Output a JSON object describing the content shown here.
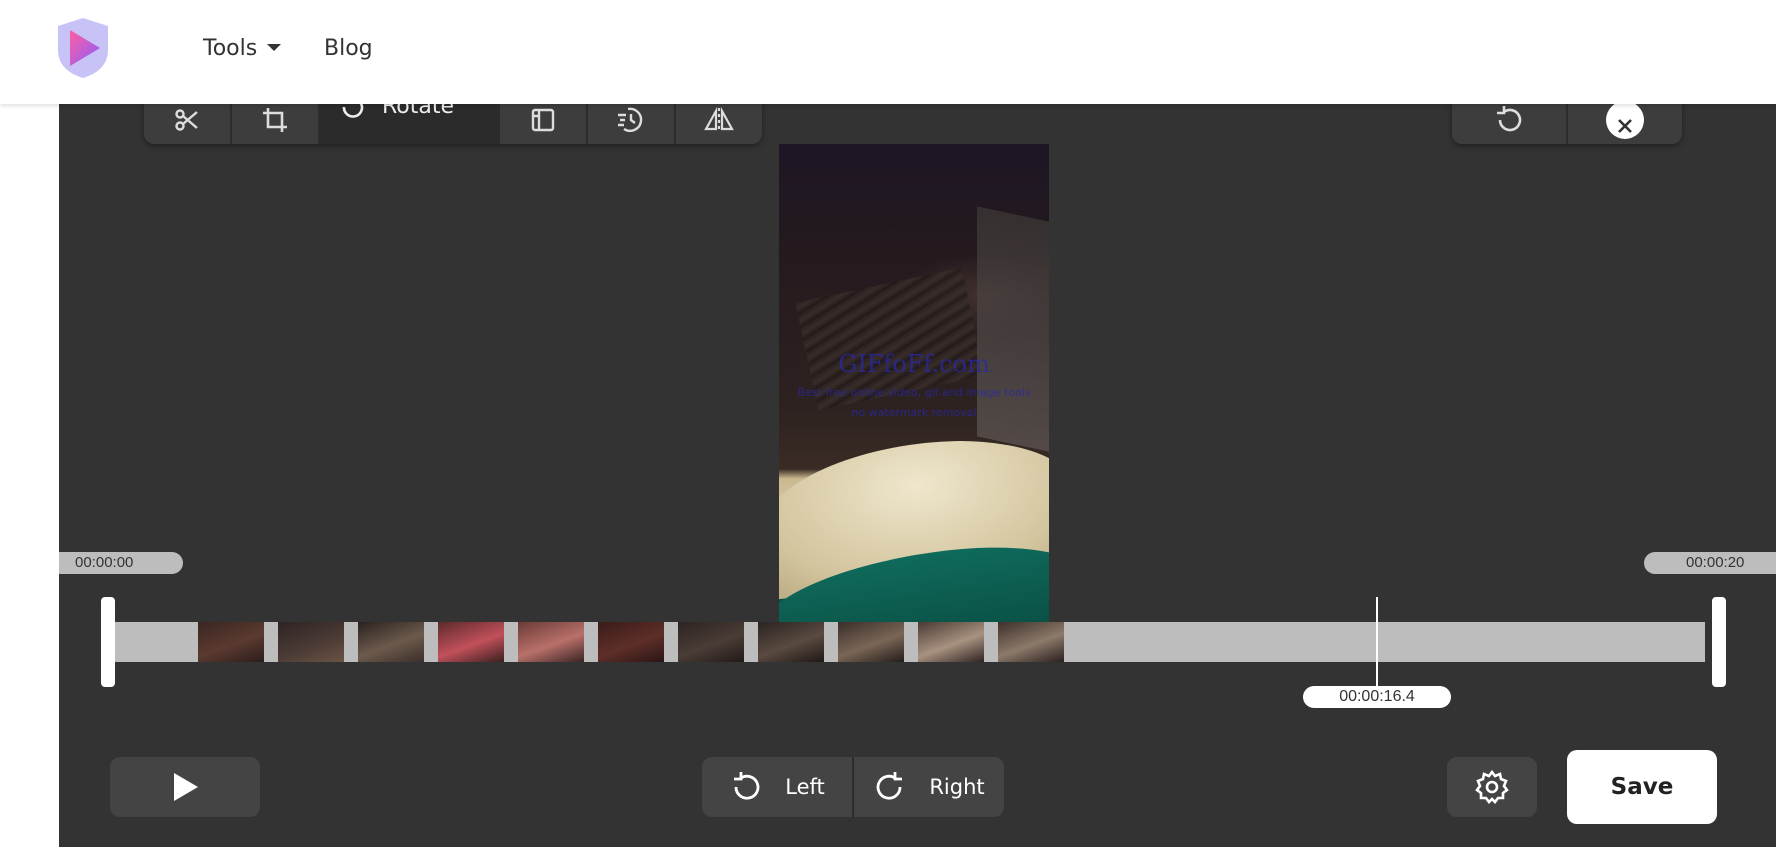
{
  "header": {
    "nav": [
      {
        "label": "Tools"
      },
      {
        "label": "Blog"
      }
    ]
  },
  "toolbar": {
    "tools": [
      {
        "icon": "scissors-icon"
      },
      {
        "icon": "crop-icon"
      },
      {
        "icon": "rotate-icon",
        "label": "Rotate",
        "active": true
      },
      {
        "icon": "resize-icon"
      },
      {
        "icon": "speed-icon"
      },
      {
        "icon": "flip-icon"
      }
    ],
    "right": [
      {
        "icon": "undo-icon"
      },
      {
        "icon": "close-icon"
      }
    ]
  },
  "preview": {
    "watermark": "GIFfoFf.com",
    "watermark_line2": "Best free online video, gif and image tools",
    "watermark_line3": "no watermark removal"
  },
  "timeline": {
    "start_time": "00:00:00",
    "end_time": "00:00:20",
    "current_time": "00:00:16.4",
    "thumbnail_count": 11
  },
  "controls": {
    "rotate_left_label": "Left",
    "rotate_right_label": "Right",
    "save_label": "Save"
  },
  "colors": {
    "editor_bg": "#333333",
    "track": "#bdbdbd",
    "button": "#444444",
    "logo_shield": "#c7c3f7",
    "logo_play_start": "#ff5fa0",
    "logo_play_end": "#8a5cff"
  }
}
